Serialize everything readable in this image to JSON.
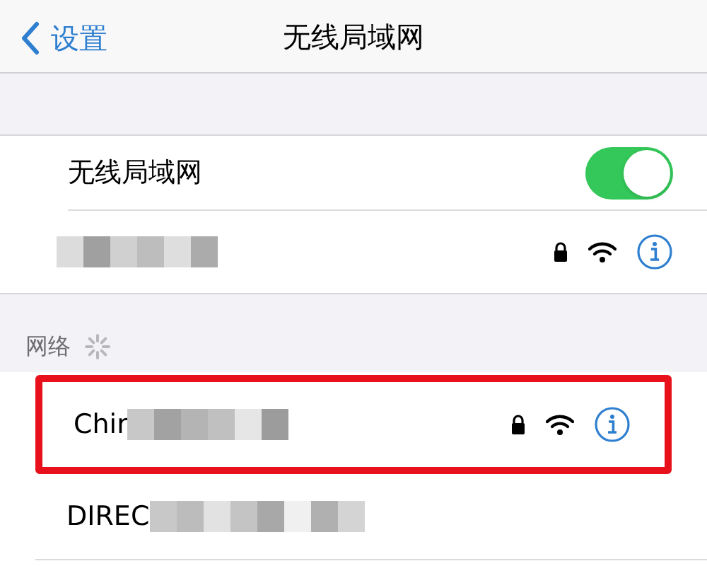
{
  "nav": {
    "back": "设置",
    "title": "无线局域网"
  },
  "wifi_toggle": {
    "label": "无线局域网",
    "on": true
  },
  "section": {
    "header": "网络",
    "loading": true
  },
  "networks": [
    {
      "name": "Chir",
      "highlighted": true,
      "cut": false
    },
    {
      "name": "DIREC",
      "highlighted": false,
      "cut": true
    }
  ]
}
